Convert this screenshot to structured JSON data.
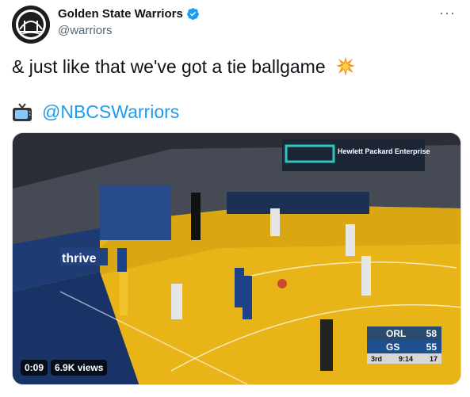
{
  "tweet": {
    "display_name": "Golden State Warriors",
    "handle": "@warriors",
    "text": "& just like that we've got a tie ballgame",
    "emoji": "collision-emoji",
    "mention_icon": "television-icon",
    "mention": "@NBCSWarriors",
    "more_label": "···"
  },
  "video": {
    "duration": "0:09",
    "views": "6.9K views",
    "court_sign_1": "thrive",
    "court_sign_2": "Hewlett Packard Enterprise",
    "scoreboard": {
      "team1": "ORL",
      "score1": "58",
      "team2": "GS",
      "score2": "55",
      "period": "3rd",
      "clock": "9:14",
      "shot_clock": "17"
    }
  },
  "colors": {
    "link": "#1d9bf0",
    "verified": "#1d9bf0",
    "court": "#e8b417"
  }
}
